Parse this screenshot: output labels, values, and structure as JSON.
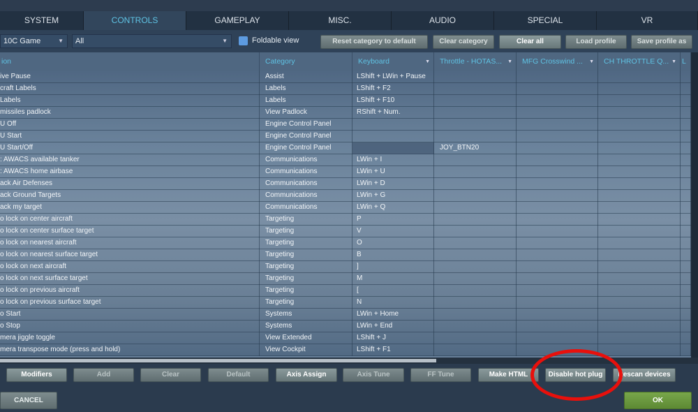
{
  "tabs": [
    "SYSTEM",
    "CONTROLS",
    "GAMEPLAY",
    "MISC.",
    "AUDIO",
    "SPECIAL",
    "VR"
  ],
  "active_tab": "CONTROLS",
  "toolbar": {
    "aircraft_select": "10C Game",
    "category_select": "All",
    "foldable_view": "Foldable view",
    "reset_category": "Reset category to default",
    "clear_category": "Clear category",
    "clear_all": "Clear all",
    "load_profile": "Load profile",
    "save_profile": "Save profile as"
  },
  "columns": [
    "ion",
    "Category",
    "Keyboard",
    "Throttle - HOTAS...",
    "MFG Crosswind ...",
    "CH THROTTLE Q...",
    "L"
  ],
  "rows": [
    [
      "ive Pause",
      "Assist",
      "LShift + LWin + Pause",
      ""
    ],
    [
      "craft Labels",
      "Labels",
      "LShift + F2",
      ""
    ],
    [
      " Labels",
      "Labels",
      "LShift + F10",
      ""
    ],
    [
      " missiles padlock",
      "View Padlock",
      "RShift + Num.",
      ""
    ],
    [
      "U Off",
      "Engine Control Panel",
      "",
      ""
    ],
    [
      "U Start",
      "Engine Control Panel",
      "",
      ""
    ],
    [
      "U Start/Off",
      "Engine Control Panel",
      "",
      "JOY_BTN20"
    ],
    [
      ": AWACS available tanker",
      "Communications",
      "LWin + I",
      ""
    ],
    [
      ": AWACS home airbase",
      "Communications",
      "LWin + U",
      ""
    ],
    [
      "ack Air Defenses",
      "Communications",
      "LWin + D",
      ""
    ],
    [
      "ack Ground Targets",
      "Communications",
      "LWin + G",
      ""
    ],
    [
      "ack my target",
      "Communications",
      "LWin + Q",
      ""
    ],
    [
      "o lock on center aircraft",
      "Targeting",
      "P",
      ""
    ],
    [
      "o lock on center surface target",
      "Targeting",
      "V",
      ""
    ],
    [
      "o lock on nearest aircraft",
      "Targeting",
      "O",
      ""
    ],
    [
      "o lock on nearest surface target",
      "Targeting",
      "B",
      ""
    ],
    [
      "o lock on next aircraft",
      "Targeting",
      "]",
      ""
    ],
    [
      "o lock on next surface target",
      "Targeting",
      "M",
      ""
    ],
    [
      "o lock on previous aircraft",
      "Targeting",
      "[",
      ""
    ],
    [
      "o lock on previous surface target",
      "Targeting",
      "N",
      ""
    ],
    [
      "o Start",
      "Systems",
      "LWin + Home",
      ""
    ],
    [
      "o Stop",
      "Systems",
      "LWin + End",
      ""
    ],
    [
      "mera jiggle toggle",
      "View Extended",
      "LShift + J",
      ""
    ],
    [
      "mera transpose mode (press and hold)",
      "View Cockpit",
      "LShift + F1",
      ""
    ]
  ],
  "bottom_buttons": [
    "Modifiers",
    "Add",
    "Clear",
    "Default",
    "Axis Assign",
    "Axis Tune",
    "FF Tune",
    "Make HTML",
    "Disable hot plug",
    "Rescan devices"
  ],
  "cancel": "CANCEL",
  "ok": "OK",
  "annotation_color": "#e8100c"
}
